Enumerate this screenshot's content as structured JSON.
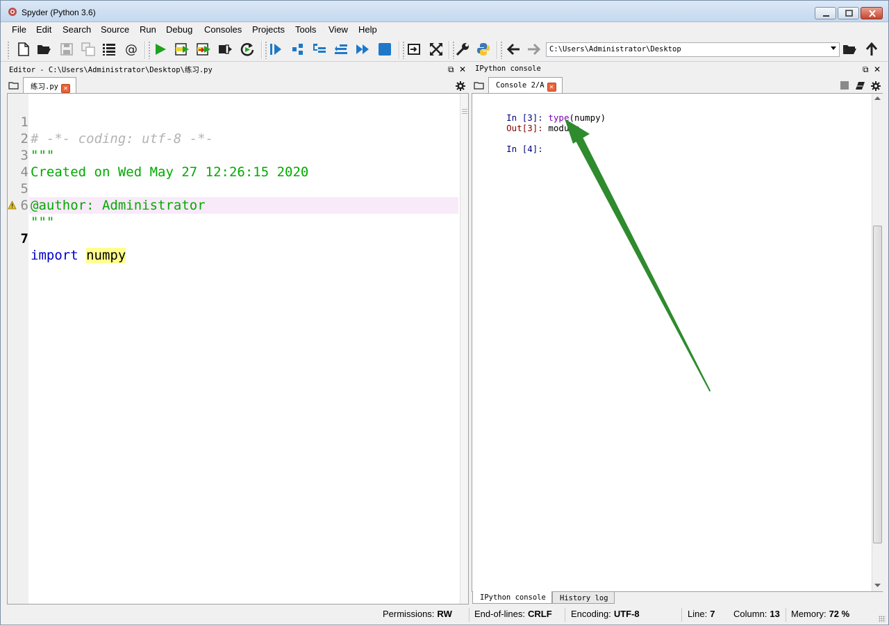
{
  "window": {
    "title": "Spyder (Python 3.6)"
  },
  "menu": [
    "File",
    "Edit",
    "Search",
    "Source",
    "Run",
    "Debug",
    "Consoles",
    "Projects",
    "Tools",
    "View",
    "Help"
  ],
  "toolbar": {
    "working_dir": "C:\\Users\\Administrator\\Desktop",
    "icons": [
      "new-file-icon",
      "open-folder-icon",
      "save-icon",
      "save-all-icon",
      "outline-list-icon",
      "at-sign-icon",
      "run-icon",
      "run-cell-icon",
      "run-cell-advance-icon",
      "run-selection-icon",
      "rerun-icon",
      "debug-icon",
      "step-icon",
      "step-into-icon",
      "step-return-icon",
      "continue-icon",
      "stop-icon",
      "maximize-pane-icon",
      "fullscreen-icon",
      "preferences-wrench-icon",
      "python-path-icon",
      "back-arrow-icon",
      "forward-arrow-icon",
      "browse-folder-icon",
      "parent-dir-arrow-icon"
    ]
  },
  "editor": {
    "pane_title": "Editor - C:\\Users\\Administrator\\Desktop\\练习.py",
    "tab_label": "练习.py",
    "lines": [
      {
        "num": "1",
        "text": "# -*- coding: utf-8 -*-"
      },
      {
        "num": "2",
        "text": "\"\"\""
      },
      {
        "num": "3",
        "text": "Created on Wed May 27 12:26:15 2020"
      },
      {
        "num": "4",
        "text": ""
      },
      {
        "num": "5",
        "text": "@author: Administrator"
      },
      {
        "num": "6",
        "text": "\"\"\""
      },
      {
        "num": "7",
        "kw": "import",
        "name": "numpy"
      }
    ]
  },
  "console": {
    "pane_title": "IPython console",
    "tab_label": "Console 2/A",
    "in3_prompt": "In [3]:",
    "in3_func": "type",
    "in3_arg": "(numpy)",
    "out3_prompt": "Out[3]:",
    "out3_value": "module",
    "in4_prompt": "In [4]:",
    "bottom_tabs": [
      "IPython console",
      "History log"
    ]
  },
  "status": {
    "permissions_label": "Permissions:",
    "permissions": "RW",
    "eol_label": "End-of-lines:",
    "eol": "CRLF",
    "encoding_label": "Encoding:",
    "encoding": "UTF-8",
    "line_label": "Line:",
    "line": "7",
    "column_label": "Column:",
    "column": "13",
    "memory_label": "Memory:",
    "memory": "72 %"
  },
  "colors": {
    "annotation_arrow": "#2e8b2e",
    "run_green": "#1ea31e",
    "toolbar_blue": "#1e78c8"
  }
}
